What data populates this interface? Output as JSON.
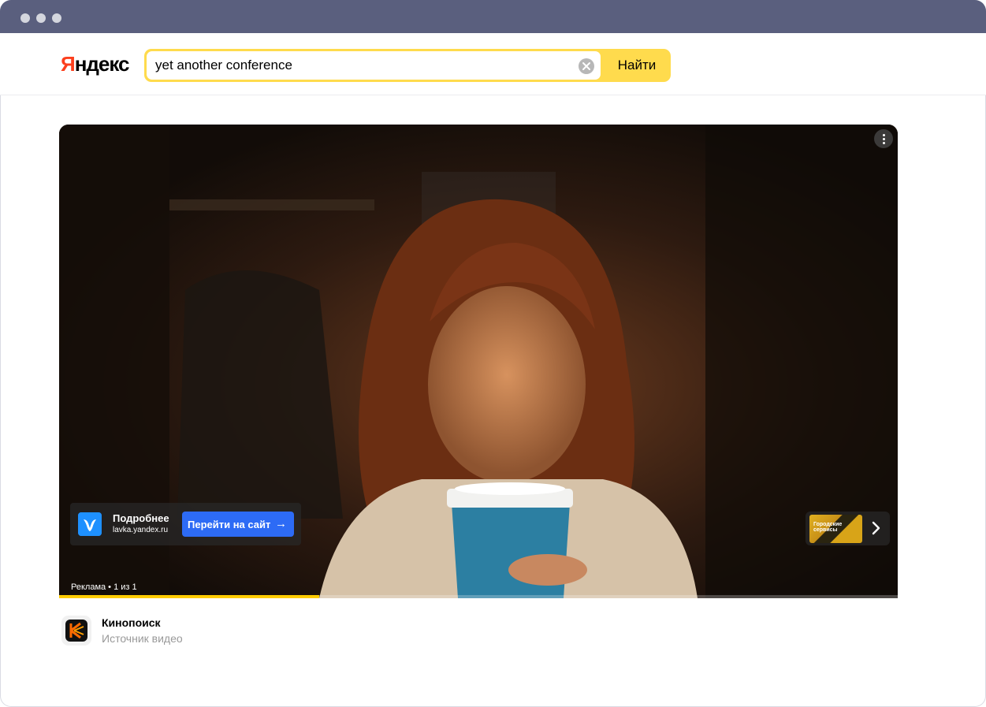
{
  "window": {
    "controls": [
      "close-dot",
      "minimize-dot",
      "maximize-dot"
    ]
  },
  "header": {
    "logo_first": "Я",
    "logo_rest": "ндекс",
    "search": {
      "value": "yet another conference",
      "clear_icon": "clear-circle-icon",
      "button_label": "Найти"
    }
  },
  "player": {
    "menu_icon": "more-vertical-icon",
    "ad_card": {
      "logo_icon": "lavka-logo-icon",
      "title": "Подробнее",
      "domain": "lavka.yandex.ru",
      "button_label": "Перейти на сайт",
      "button_icon": "arrow-right-icon"
    },
    "next_card": {
      "thumb_text": "Городские сервисы",
      "chevron_icon": "chevron-right-icon"
    },
    "ad_counter": "Реклама • 1 из 1",
    "progress": 0.31
  },
  "source": {
    "icon": "kinopoisk-logo-icon",
    "title": "Кинопоиск",
    "subtitle": "Источник видео"
  },
  "colors": {
    "titlebar": "#5a5f7e",
    "search_border": "#ffdb4d",
    "logo_accent": "#fc3f1d",
    "ad_button": "#2d6bf5",
    "progress": "#ffcc00"
  }
}
